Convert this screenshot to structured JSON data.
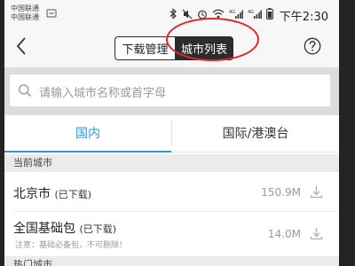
{
  "status_bar": {
    "carrier_1": "中国联通",
    "carrier_2": "中国联通",
    "icons": [
      "bluetooth-icon",
      "mute-icon",
      "alarm-icon",
      "wifi-icon",
      "signal-4g-icon",
      "signal-4g-icon",
      "battery-icon"
    ],
    "time": "下午2:30"
  },
  "nav": {
    "back_icon": "chevron-left-icon",
    "segment_left": "下载管理",
    "segment_right": "城市列表",
    "selected_segment": "城市列表",
    "highlight_color": "#e3262b",
    "help_icon": "question-circle-icon"
  },
  "search": {
    "icon": "search-icon",
    "placeholder": "请输入城市名称或首字母"
  },
  "tabs": [
    {
      "label": "国内",
      "active": true
    },
    {
      "label": "国际/港澳台",
      "active": false
    }
  ],
  "accent_color": "#3296d8",
  "current_city": {
    "header": "当前城市",
    "items": [
      {
        "name": "北京市",
        "status": "(已下载)",
        "size": "150.9M",
        "icon": "download-icon"
      },
      {
        "name": "全国基础包",
        "status": "(已下载)",
        "note": "注意：基础必备包，不可删除！",
        "size": "14.0M",
        "icon": "download-icon"
      }
    ]
  },
  "hot_city": {
    "header": "热门城市"
  }
}
